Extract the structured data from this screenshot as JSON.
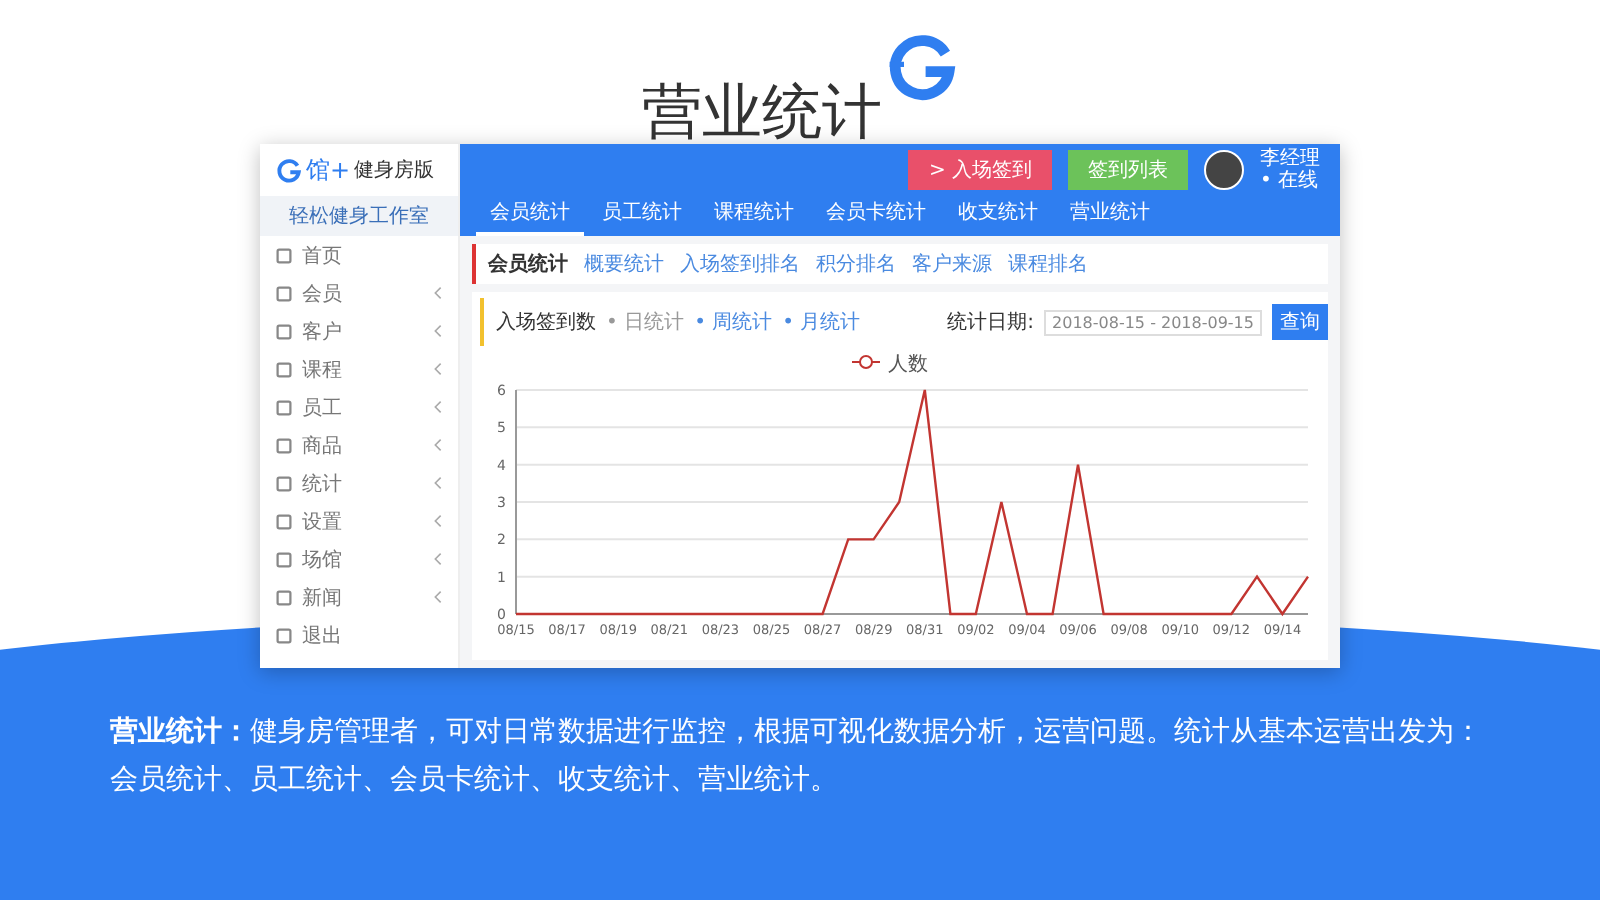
{
  "title": "营业统计",
  "app": {
    "logo": "馆+",
    "logo_sub": "健身房版",
    "studio": "轻松健身工作室",
    "buttons": [
      {
        "label": "> 入场签到",
        "kind": "danger"
      },
      {
        "label": "签到列表",
        "kind": "success"
      }
    ],
    "user": {
      "name": "李经理",
      "status": "• 在线"
    },
    "sidebar": [
      {
        "label": "首页",
        "expandable": false
      },
      {
        "label": "会员",
        "expandable": true
      },
      {
        "label": "客户",
        "expandable": true
      },
      {
        "label": "课程",
        "expandable": true
      },
      {
        "label": "员工",
        "expandable": true
      },
      {
        "label": "商品",
        "expandable": true
      },
      {
        "label": "统计",
        "expandable": true
      },
      {
        "label": "设置",
        "expandable": true
      },
      {
        "label": "场馆",
        "expandable": true
      },
      {
        "label": "新闻",
        "expandable": true
      },
      {
        "label": "退出",
        "expandable": false
      }
    ],
    "tabs": [
      {
        "label": "会员统计",
        "selected": true
      },
      {
        "label": "员工统计",
        "selected": false
      },
      {
        "label": "课程统计",
        "selected": false
      },
      {
        "label": "会员卡统计",
        "selected": false
      },
      {
        "label": "收支统计",
        "selected": false
      },
      {
        "label": "营业统计",
        "selected": false
      }
    ],
    "subnav_title": "会员统计",
    "subnav": [
      "概要统计",
      "入场签到排名",
      "积分排名",
      "客户来源",
      "课程排名"
    ],
    "panel": {
      "title": "入场签到数",
      "periods": [
        {
          "label": "• 日统计",
          "selected": false
        },
        {
          "label": "• 周统计",
          "selected": true
        },
        {
          "label": "• 月统计",
          "selected": true
        }
      ],
      "date_label": "统计日期:",
      "date_value": "2018-08-15 - 2018-09-15",
      "button": "查询",
      "chart_data": {
        "type": "line",
        "grid": true,
        "categories": [
          "08/15",
          null,
          "08/17",
          null,
          "08/19",
          null,
          "08/21",
          null,
          "08/23",
          null,
          "08/25",
          null,
          "08/27",
          null,
          "08/29",
          null,
          "08/31",
          null,
          "09/02",
          null,
          "09/04",
          null,
          "09/06",
          null,
          "09/08",
          null,
          "09/10",
          null,
          "09/12",
          null,
          "09/14",
          null
        ],
        "ylim": [
          0,
          6
        ],
        "yticks": [
          0,
          1,
          2,
          3,
          4,
          5,
          6
        ],
        "series": [
          {
            "name": "人数",
            "color": "#c23531",
            "values": [
              0,
              0,
              0,
              0,
              0,
              0,
              0,
              0,
              0,
              0,
              0,
              0,
              0,
              2,
              2,
              3,
              6,
              0,
              0,
              3,
              0,
              0,
              4,
              0,
              0,
              0,
              0,
              0,
              0,
              1,
              0,
              1
            ]
          }
        ]
      }
    }
  },
  "description": "**营业统计：**健身房管理者，可对日常数据进行监控，根据可视化数据分析，运营问题。统计从基本运营出发为：会员统计、员工统计、会员卡统计、收支统计、营业统计。"
}
